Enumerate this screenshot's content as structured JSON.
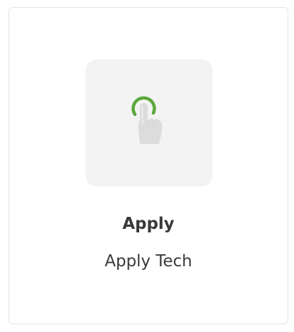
{
  "card": {
    "title": "Apply",
    "subtitle": "Apply Tech",
    "logo_icon": "tap-hand-icon",
    "accent_color": "#5aa83a",
    "icon_color": "#dcdcdc"
  }
}
